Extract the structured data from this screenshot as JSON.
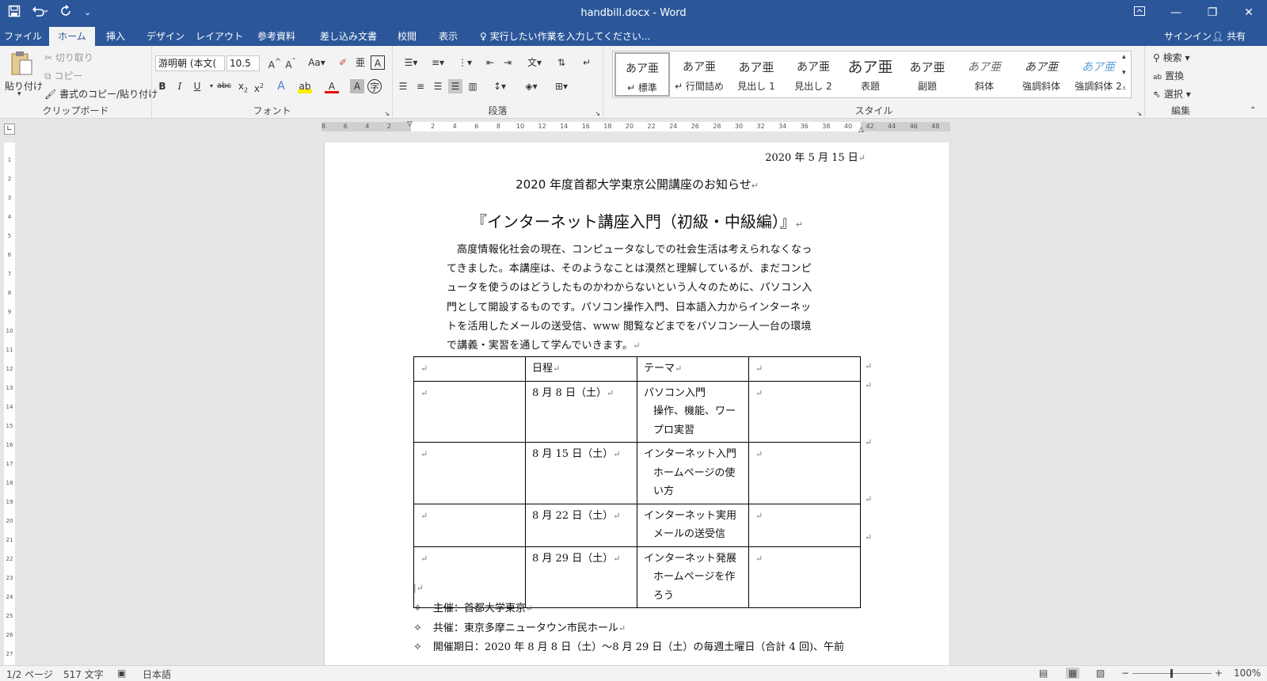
{
  "titlebar": {
    "title": "handbill.docx - Word",
    "save_icon": "save-icon",
    "undo_icon": "undo-icon",
    "redo_icon": "redo-icon"
  },
  "tabs": [
    "ファイル",
    "ホーム",
    "挿入",
    "デザイン",
    "レイアウト",
    "参考資料",
    "差し込み文書",
    "校閲",
    "表示"
  ],
  "tell_me": "実行したい作業を入力してください...",
  "signin": "サインイン",
  "share": "共有",
  "clipboard": {
    "paste": "貼り付け",
    "cut": "切り取り",
    "copy": "コピー",
    "format_painter": "書式のコピー/貼り付け",
    "label": "クリップボード"
  },
  "font": {
    "name": "游明朝 (本文(",
    "size": "10.5",
    "label": "フォント"
  },
  "paragraph": {
    "label": "段落"
  },
  "styles": {
    "label": "スタイル",
    "items": [
      {
        "preview": "あア亜",
        "name": "↵ 標準"
      },
      {
        "preview": "あア亜",
        "name": "↵ 行間詰め"
      },
      {
        "preview": "あア亜",
        "name": "見出し 1"
      },
      {
        "preview": "あア亜",
        "name": "見出し 2"
      },
      {
        "preview": "あア亜",
        "name": "表題"
      },
      {
        "preview": "あア亜",
        "name": "副題"
      },
      {
        "preview": "あア亜",
        "name": "斜体"
      },
      {
        "preview": "あア亜",
        "name": "強調斜体"
      },
      {
        "preview": "あア亜",
        "name": "強調斜体 2"
      }
    ]
  },
  "editing": {
    "find": "検索",
    "replace": "置換",
    "select": "選択",
    "label": "編集"
  },
  "document": {
    "date": "2020 年 5 月 15 日",
    "heading": "2020 年度首都大学東京公開講座のお知らせ",
    "title": "『インターネット講座入門（初級・中級編）』",
    "body": "高度情報化社会の現在、コンピュータなしでの社会生活は考えられなくなってきました。本講座は、そのようなことは漠然と理解しているが、まだコンピュータを使うのはどうしたものかわからないという人々のために、パソコン入門として開設するものです。パソコン操作入門、日本語入力からインターネットを活用したメールの送受信、www 閲覧などまでをパソコン一人一台の環境で講義・実習を通して学んでいきます。",
    "table": {
      "headers": [
        "",
        "日程",
        "テーマ",
        ""
      ],
      "rows": [
        {
          "date": "8 月 8 日（土）",
          "theme": "パソコン入門",
          "detail": "操作、機能、ワープロ実習"
        },
        {
          "date": "8 月 15 日（土）",
          "theme": "インターネット入門",
          "detail": "ホームページの使い方"
        },
        {
          "date": "8 月 22 日（土）",
          "theme": "インターネット実用",
          "detail": "メールの送受信"
        },
        {
          "date": "8 月 29 日（土）",
          "theme": "インターネット発展",
          "detail": "ホームページを作ろう"
        }
      ]
    },
    "bullets": [
      "主催：首都大学東京",
      "共催：東京多摩ニュータウン市民ホール",
      "開催期日：2020 年 8 月 8 日（土）～8 月 29 日（土）の毎週土曜日（合計 4 回)、午前"
    ]
  },
  "statusbar": {
    "page": "1/2 ページ",
    "words": "517 文字",
    "language": "日本語",
    "zoom": "100%"
  }
}
